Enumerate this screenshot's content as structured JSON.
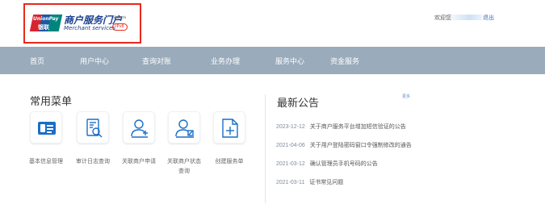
{
  "colors": {
    "nav_bg": "#9aabbb",
    "accent_blue": "#1b6ec6",
    "logo_red": "#d7252f",
    "logo_blue": "#1b58a6",
    "logo_green": "#00857d",
    "highlight_border": "#e8291d"
  },
  "header": {
    "logo": {
      "brand_latin": "UnionPay",
      "brand_cn": "银联",
      "title": "商户服务门户",
      "subtitle": "Merchant services",
      "support_note": "网站支持",
      "ipv6_badge": "IPv6"
    },
    "welcome_label": "欢迎您，",
    "logout_label": "退出"
  },
  "nav": {
    "items": [
      {
        "label": "首页",
        "icon": ""
      },
      {
        "label": "用户中心",
        "icon": ""
      },
      {
        "label": "查询对账",
        "icon": ""
      },
      {
        "label": "业务办理",
        "icon": ""
      },
      {
        "label": "服务中心",
        "icon": ""
      },
      {
        "label": "资金服务",
        "icon": ""
      }
    ]
  },
  "common_menu": {
    "title": "常用菜单",
    "items": [
      {
        "label": "基本信息管理",
        "icon": "id-card-icon"
      },
      {
        "label": "审计日志查询",
        "icon": "document-search-icon"
      },
      {
        "label": "关联商户申请",
        "icon": "add-user-icon"
      },
      {
        "label": "关联商户状态查询",
        "icon": "user-edit-icon"
      },
      {
        "label": "创建服务单",
        "icon": "new-document-icon"
      }
    ]
  },
  "announcements": {
    "title": "最新公告",
    "more_label": "更多",
    "items": [
      {
        "date": "2023-12-12",
        "title": "关于商户服务平台增加短信验证的公告"
      },
      {
        "date": "2021-04-06",
        "title": "关于用户登陆密码窗口令强制修改的通告"
      },
      {
        "date": "2021-03-12",
        "title": "确认管理员手机号码的公告"
      },
      {
        "date": "2021-03-11",
        "title": "证书常见问题"
      }
    ]
  }
}
